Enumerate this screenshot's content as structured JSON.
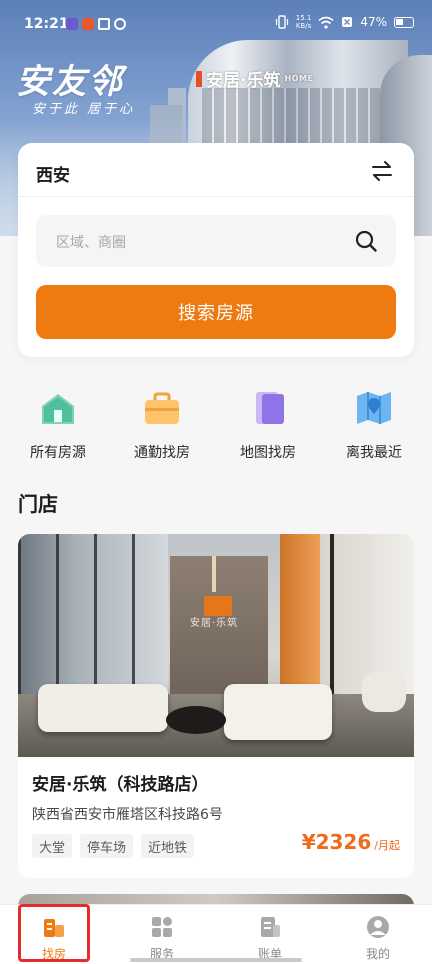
{
  "status_bar": {
    "time": "12:21",
    "net_speed_value": "15.1",
    "net_speed_unit": "KB/s",
    "battery": "47%"
  },
  "hero": {
    "brand": "安友邻",
    "tagline": "安于此 居于心",
    "building_sign": "安居·乐筑",
    "building_sign_sub": "HOME"
  },
  "search_card": {
    "city": "西安",
    "search_placeholder": "区域、商圈",
    "search_button": "搜索房源"
  },
  "quick_entries": [
    {
      "label": "所有房源",
      "icon": "house-icon"
    },
    {
      "label": "通勤找房",
      "icon": "briefcase-icon"
    },
    {
      "label": "地图找房",
      "icon": "map-card-icon"
    },
    {
      "label": "离我最近",
      "icon": "map-pin-icon"
    }
  ],
  "section": {
    "title": "门店"
  },
  "store": {
    "photo_sign": "安居·乐筑",
    "name": "安居·乐筑（科技路店）",
    "address": "陕西省西安市雁塔区科技路6号",
    "tags": [
      "大堂",
      "停车场",
      "近地铁"
    ],
    "price": "¥2326",
    "price_unit": "/月起"
  },
  "bottom_nav": [
    {
      "label": "找房",
      "icon": "find-house-icon",
      "active": true
    },
    {
      "label": "服务",
      "icon": "services-grid-icon",
      "active": false
    },
    {
      "label": "账单",
      "icon": "bill-icon",
      "active": false
    },
    {
      "label": "我的",
      "icon": "profile-icon",
      "active": false
    }
  ],
  "colors": {
    "accent": "#ee7b12",
    "price": "#ee6a1c",
    "highlight_box": "#e52b2b"
  }
}
